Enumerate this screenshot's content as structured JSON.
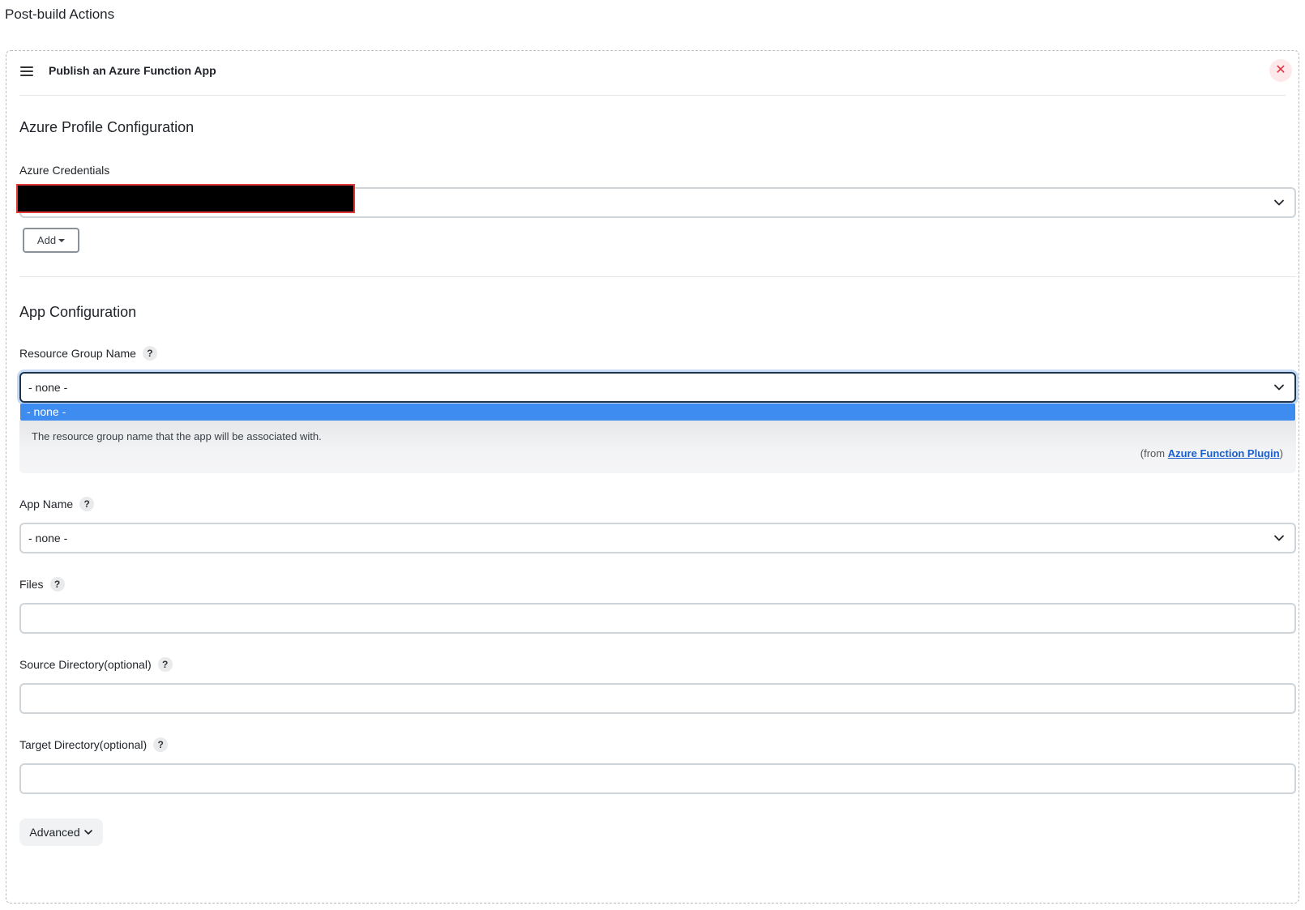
{
  "page": {
    "section_title": "Post-build Actions"
  },
  "panel": {
    "title": "Publish an Azure Function App",
    "close_symbol": "✕"
  },
  "azure_profile": {
    "heading": "Azure Profile Configuration",
    "credentials_label": "Azure Credentials",
    "credentials_value": "",
    "add_button_label": "Add"
  },
  "app_config": {
    "heading": "App Configuration",
    "resource_group": {
      "label": "Resource Group Name",
      "value": "- none -",
      "open_option": "- none -",
      "help_text": "The resource group name that the app will be associated with.",
      "help_source_prefix": "(from ",
      "help_source_link": "Azure Function Plugin",
      "help_source_suffix": ")"
    },
    "app_name": {
      "label": "App Name",
      "value": "- none -"
    },
    "files": {
      "label": "Files",
      "value": ""
    },
    "source_dir": {
      "label": "Source Directory(optional)",
      "value": ""
    },
    "target_dir": {
      "label": "Target Directory(optional)",
      "value": ""
    },
    "advanced_label": "Advanced"
  },
  "icons": {
    "help": "?",
    "drag": "drag-handle-icon",
    "chevron": "chevron-down-icon"
  },
  "colors": {
    "highlight_option": "#3f8cf0",
    "close_bg": "#fde8ea",
    "close_fg": "#e0303f",
    "focus_border": "#1b3550",
    "link": "#1a5fd0"
  }
}
